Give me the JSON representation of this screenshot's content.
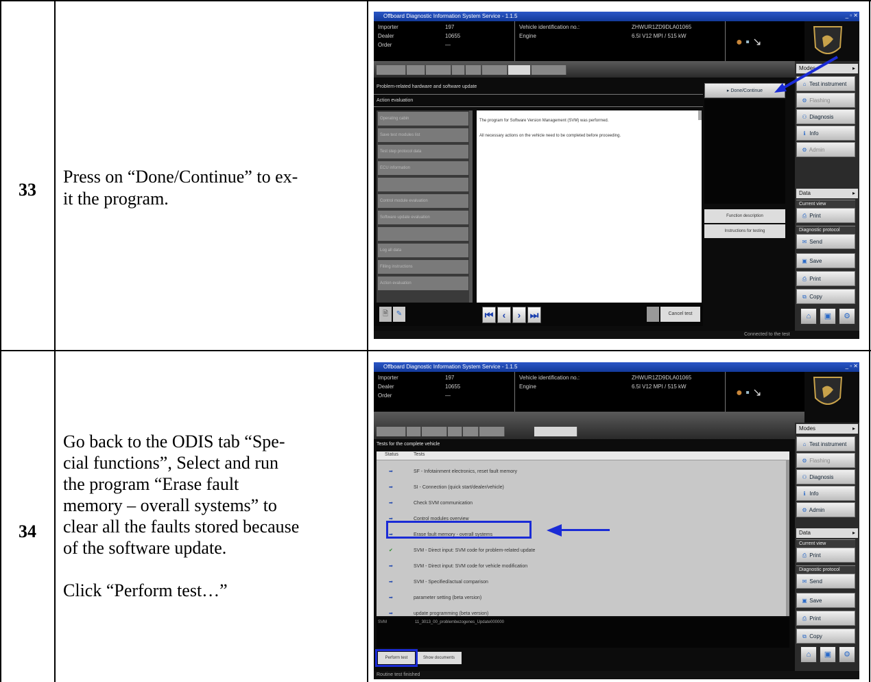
{
  "rows": [
    {
      "number": "33",
      "lines": [
        "Press on “Done/Continue” to ex-",
        "it the program."
      ]
    },
    {
      "number": "34",
      "paragraphs": [
        [
          "Go back to the ODIS tab “Spe-",
          "cial functions”, Select and run",
          "the program “Erase fault",
          "memory – overall systems” to",
          "clear all the faults stored because",
          "of the software update."
        ],
        [
          "Click “Perform test…”"
        ]
      ]
    }
  ],
  "shot1": {
    "title": "Offboard Diagnostic Information System Service - 1.1.5",
    "header": {
      "importer_label": "Importer",
      "importer_value": "197",
      "dealer_label": "Dealer",
      "dealer_value": "10655",
      "order_label": "Order",
      "order_value": "—",
      "vin_label": "Vehicle identification no.:",
      "vin_value": "ZHWUR1ZD9DLA01065",
      "engine_label": "Engine",
      "engine_value": "6.5l V12 MPI / 515 kW"
    },
    "section1": "Problem-related hardware and software update",
    "section2": "Action evaluation",
    "done_button": "▸ Done/Continue",
    "message1": "The program for Software Version Management (SVM) was performed.",
    "message2": "All necessary actions on the vehicle need to be completed before proceeding.",
    "function_description": "Function description",
    "instructions": "Instructions for testing",
    "cancel": "Cancel test",
    "status": "Connected to the test",
    "side_items": [
      "Operating cabin",
      "Save test modules list",
      "Test step protocol data",
      "ECU information",
      "",
      "Control module evaluation",
      "Software update evaluation",
      "",
      "Log all data",
      "Filling instructions",
      "Action evaluation"
    ]
  },
  "shot2": {
    "title": "Offboard Diagnostic Information System Service - 1.1.5",
    "header": {
      "importer_label": "Importer",
      "importer_value": "197",
      "dealer_label": "Dealer",
      "dealer_value": "10655",
      "order_label": "Order",
      "order_value": "—",
      "vin_label": "Vehicle identification no.:",
      "vin_value": "ZHWUR1ZD9DLA01065",
      "engine_label": "Engine",
      "engine_value": "6.5l V12 MPI / 515 kW"
    },
    "panel_title": "Tests for the complete vehicle",
    "col_status": "Status",
    "col_tests": "Tests",
    "tests": [
      "SF - Infotainment electronics, reset fault memory",
      "SI - Connection (quick start/dealer/vehicle)",
      "Check SVM communication",
      "Control modules overview",
      "Erase fault memory - overall systems",
      "SVM - Direct input: SVM code for problem-related update",
      "SVM - Direct input: SVM code for vehicle modification",
      "SVM - Specified/actual comparison",
      "parameter setting (beta version)",
      "update programming (beta version)"
    ],
    "svm_label": "SVM",
    "svm_path": "11_3013_00_problembezogenes_Update000000",
    "perform": "Perform test",
    "show_docs": "Show documents",
    "status": "Routine test finished"
  },
  "sidebar": {
    "modes_label": "Modes",
    "modes": [
      "Test instrument",
      "Flashing",
      "Diagnosis",
      "Info",
      "Admin"
    ],
    "data_label": "Data",
    "current_view": "Current view",
    "print": "Print",
    "diag_protocol": "Diagnostic protocol",
    "send": "Send",
    "save": "Save",
    "print2": "Print",
    "copy": "Copy"
  }
}
